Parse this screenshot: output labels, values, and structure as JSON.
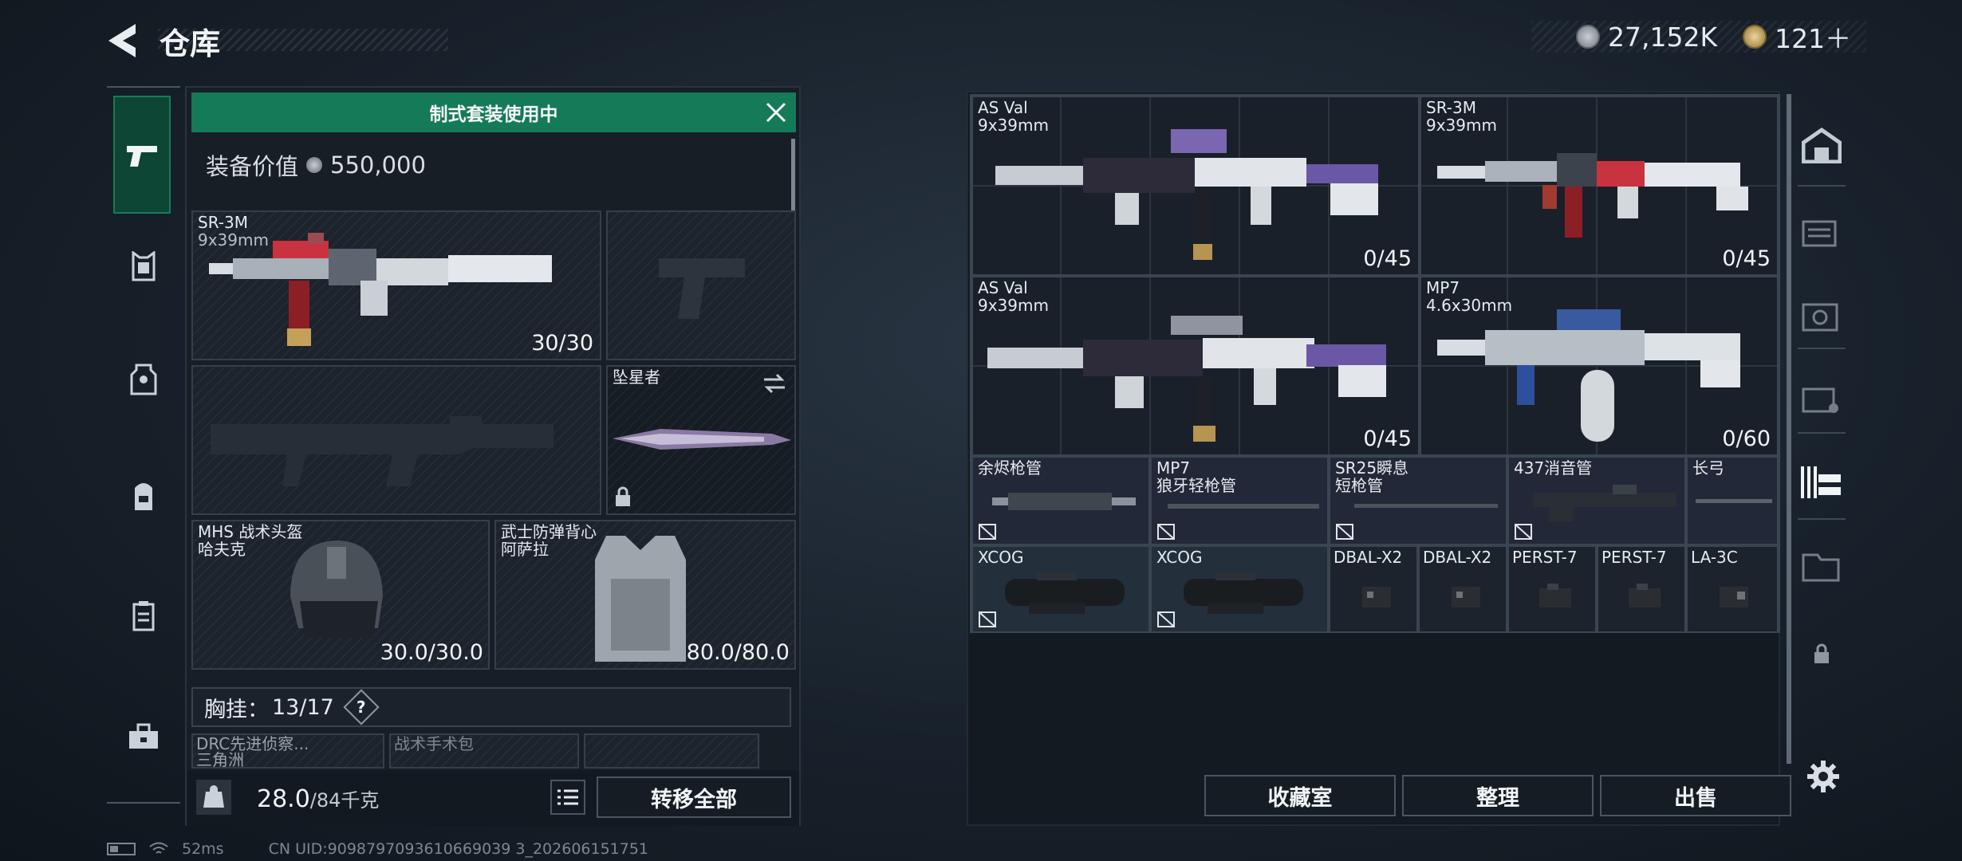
{
  "header": {
    "title": "仓库",
    "currency1": "27,152K",
    "currency2": "121＋"
  },
  "loadout": {
    "banner": "制式套装使用中",
    "value_label": "装备价值",
    "value": "550,000",
    "primary": {
      "name": "SR-3M",
      "caliber": "9x39mm",
      "count": "30/30"
    },
    "melee": {
      "name": "坠星者"
    },
    "helmet": {
      "line1": "MHS 战术头盔",
      "line2": "哈夫克",
      "durability": "30.0/30.0"
    },
    "armor": {
      "line1": "武士防弹背心",
      "line2": "阿萨拉",
      "durability": "80.0/80.0"
    },
    "chest_rig": {
      "label": "胸挂：",
      "count": "13/17",
      "help": "?"
    },
    "sub_items": [
      "DRC先进侦察...",
      "三角洲",
      "战术手术包"
    ]
  },
  "footer": {
    "weight": "28.0",
    "weight_max": "/84千克",
    "transfer_all": "转移全部",
    "bag_icon_text": "KG"
  },
  "storage": {
    "weapons": [
      {
        "name": "AS Val",
        "caliber": "9x39mm",
        "count": "0/45"
      },
      {
        "name": "SR-3M",
        "caliber": "9x39mm",
        "count": "0/45"
      },
      {
        "name": "AS Val",
        "caliber": "9x39mm",
        "count": "0/45"
      },
      {
        "name": "MP7",
        "caliber": "4.6x30mm",
        "count": "0/60"
      }
    ],
    "barrels": [
      {
        "line1": "余烬枪管",
        "line2": ""
      },
      {
        "line1": "MP7",
        "line2": "狼牙轻枪管"
      },
      {
        "line1": "SR25瞬息",
        "line2": "短枪管"
      },
      {
        "line1": "437消音管",
        "line2": ""
      },
      {
        "line1": "长弓",
        "line2": ""
      }
    ],
    "optics": [
      "XCOG",
      "XCOG",
      "DBAL-X2",
      "DBAL-X2",
      "PERST-7",
      "PERST-7",
      "LA-3C"
    ]
  },
  "actions": {
    "collection": "收藏室",
    "sort": "整理",
    "sell": "出售"
  },
  "status": {
    "ping": "52ms",
    "uid": "CN UID:9098797093610669039 3_202606151751"
  },
  "colors": {
    "accent_green": "#157a58",
    "panel": "#1b222b",
    "border": "#3a4653"
  }
}
